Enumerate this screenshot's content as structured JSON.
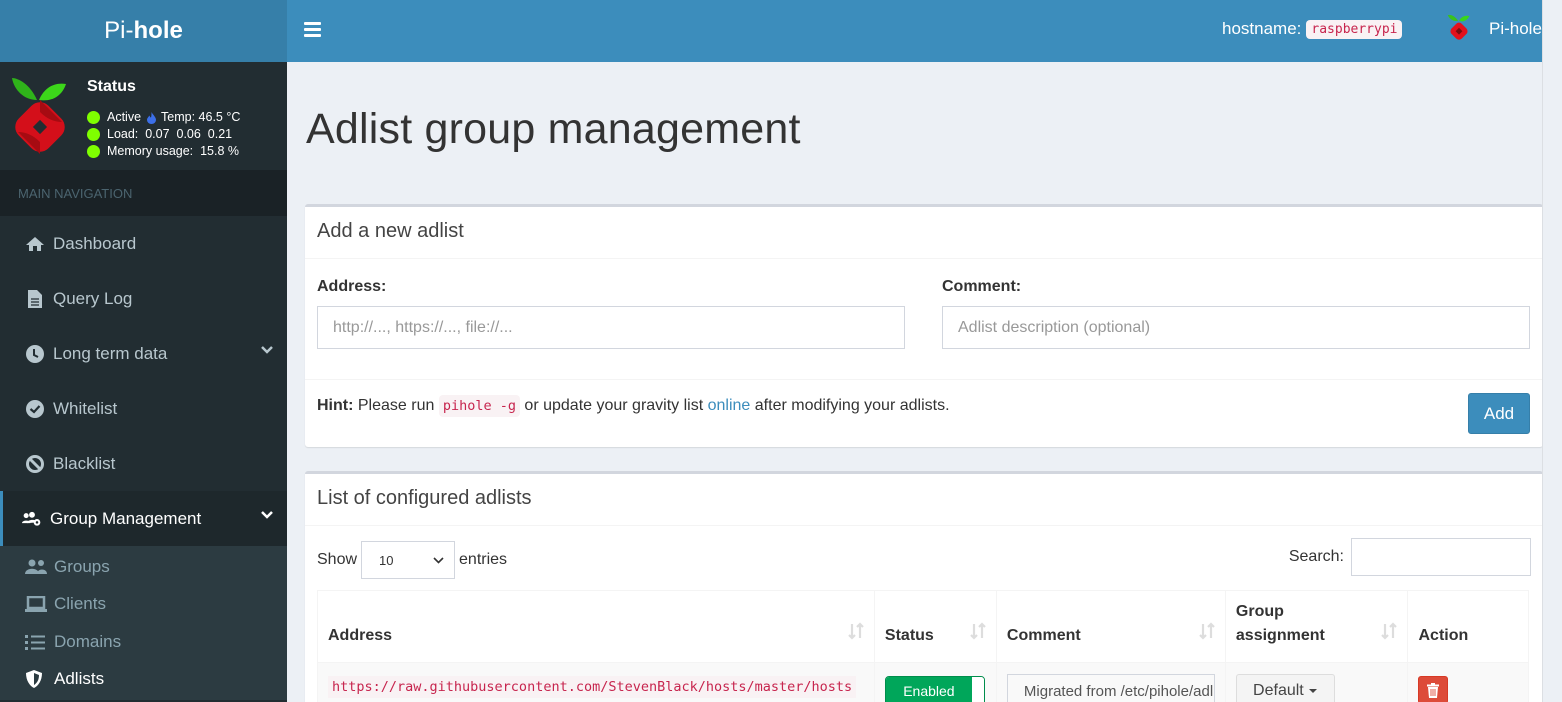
{
  "app": {
    "logo_light": "Pi-",
    "logo_bold": "hole",
    "hostname_label": "hostname:",
    "hostname_value": "raspberrypi",
    "user_menu_label": "Pi-hole"
  },
  "status": {
    "title": "Status",
    "active_label": "Active",
    "temp_label": "Temp: 46.5 °C",
    "load_label": "Load:  0.07  0.06  0.21",
    "memory_label": "Memory usage:  15.8 %",
    "indicator_color": "#7fff00"
  },
  "sidebar": {
    "header": "MAIN NAVIGATION",
    "items": [
      {
        "label": "Dashboard",
        "icon": "home-icon"
      },
      {
        "label": "Query Log",
        "icon": "file-icon"
      },
      {
        "label": "Long term data",
        "icon": "clock-icon"
      },
      {
        "label": "Whitelist",
        "icon": "check-circle-icon"
      },
      {
        "label": "Blacklist",
        "icon": "ban-icon"
      },
      {
        "label": "Group Management",
        "icon": "users-cog-icon"
      }
    ],
    "subitems": [
      {
        "label": "Groups",
        "icon": "user-friends-icon"
      },
      {
        "label": "Clients",
        "icon": "laptop-icon"
      },
      {
        "label": "Domains",
        "icon": "list-icon"
      },
      {
        "label": "Adlists",
        "icon": "shield-icon"
      }
    ]
  },
  "page": {
    "title": "Adlist group management"
  },
  "add_box": {
    "title": "Add a new adlist",
    "address_label": "Address:",
    "address_placeholder": "http://..., https://..., file://...",
    "comment_label": "Comment:",
    "comment_placeholder": "Adlist description (optional)",
    "hint_label": "Hint:",
    "hint_text1": " Please run ",
    "hint_code": "pihole -g",
    "hint_text2": " or update your gravity list ",
    "hint_link": "online",
    "hint_text3": " after modifying your adlists.",
    "add_button": "Add"
  },
  "list_box": {
    "title": "List of configured adlists",
    "show_label": "Show",
    "entries_value": "10",
    "entries_label": "entries",
    "search_label": "Search:",
    "search_value": "",
    "columns": [
      "Address",
      "Status",
      "Comment",
      "Group assignment",
      "Action"
    ],
    "rows": [
      {
        "address": "https://raw.githubusercontent.com/StevenBlack/hosts/master/hosts",
        "status": "Enabled",
        "comment": "Migrated from /etc/pihole/adlists.list",
        "group": "Default"
      }
    ]
  },
  "colors": {
    "navbar": "#3c8dbc",
    "logo_bar": "#367fa9",
    "sidebar": "#222d32",
    "enabled": "#00a65a",
    "danger": "#dd4b39"
  }
}
